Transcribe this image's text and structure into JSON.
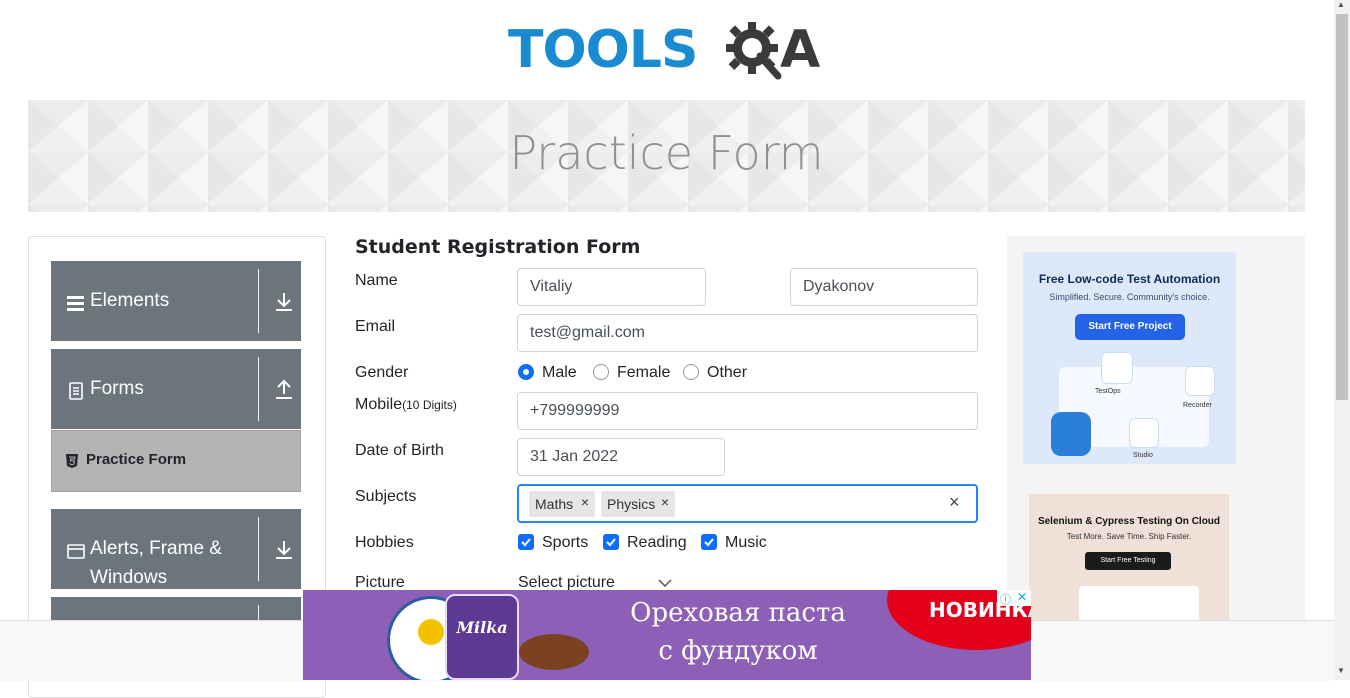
{
  "brand": {
    "logo_text": "TOOLS",
    "logo_suffix": "A",
    "accent": "#1a8bd0"
  },
  "banner": {
    "title": "Practice Form"
  },
  "sidebar": {
    "groups": [
      {
        "label": "Elements",
        "icon": "hamburger-icon",
        "arrow": "download-arrow-icon"
      },
      {
        "label": "Forms",
        "icon": "document-icon",
        "arrow": "upload-arrow-icon"
      },
      {
        "label": "Alerts, Frame &",
        "label2": "Windows",
        "icon": "window-icon",
        "arrow": "download-arrow-icon"
      }
    ],
    "active_item": {
      "label": "Practice Form",
      "icon": "html5-shield-icon"
    }
  },
  "form": {
    "heading": "Student Registration Form",
    "name": {
      "label": "Name",
      "first": "Vitaliy",
      "last": "Dyakonov"
    },
    "email": {
      "label": "Email",
      "value": "test@gmail.com"
    },
    "gender": {
      "label": "Gender",
      "options": [
        "Male",
        "Female",
        "Other"
      ],
      "selected": "Male"
    },
    "mobile": {
      "label": "Mobile",
      "hint": "(10 Digits)",
      "value": "+799999999"
    },
    "dob": {
      "label": "Date of Birth",
      "value": "31 Jan 2022"
    },
    "subjects": {
      "label": "Subjects",
      "chips": [
        "Maths",
        "Physics"
      ],
      "remove_glyph": "×",
      "clear_glyph": "×"
    },
    "hobbies": {
      "label": "Hobbies",
      "options": [
        "Sports",
        "Reading",
        "Music"
      ],
      "checked": [
        "Sports",
        "Reading",
        "Music"
      ]
    },
    "picture": {
      "label": "Picture",
      "button": "Select picture"
    }
  },
  "ads": {
    "ad1": {
      "title": "Free Low-code Test Automation",
      "subtitle": "Simplified. Secure. Community's choice.",
      "cta": "Start Free Project",
      "labels": [
        "TestOps",
        "Recorder",
        "Studio"
      ]
    },
    "ad2": {
      "title": "Selenium & Cypress Testing On Cloud",
      "subtitle": "Test More. Save Time. Ship Faster.",
      "cta": "Start Free Testing"
    },
    "bottom": {
      "line1": "Ореховая паста",
      "line2": "с фундуком",
      "badge": "НОВИНКА",
      "brand": "Milka"
    }
  }
}
